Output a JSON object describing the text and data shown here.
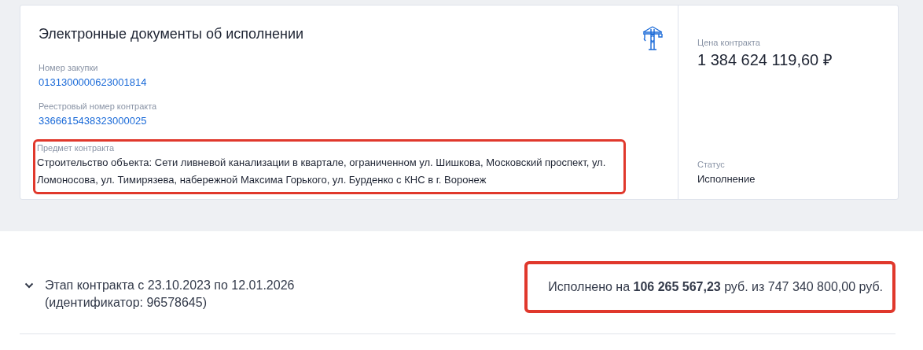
{
  "card": {
    "title": "Электронные документы об исполнении",
    "fields": [
      {
        "label": "Номер закупки",
        "value": "0131300000623001814",
        "kind": "link",
        "highlighted": false
      },
      {
        "label": "Реестровый номер контракта",
        "value": "3366615438323000025",
        "kind": "link",
        "highlighted": false
      },
      {
        "label": "Предмет контракта",
        "value": "Строительство объекта: Сети ливневой канализации в квартале, ограниченном ул. Шишкова, Московский проспект, ул. Ломоносова, ул. Тимирязева, набережной Максима Горького, ул. Бурденко с КНС в г. Воронеж",
        "kind": "text",
        "highlighted": true
      }
    ],
    "side": [
      {
        "label": "Цена контракта",
        "value": "1 384 624 119,60 ₽",
        "kind": "price"
      },
      {
        "label": "Статус",
        "value": "Исполнение",
        "kind": "text"
      }
    ]
  },
  "stage": {
    "expanded": false,
    "title": "Этап контракта с 23.10.2023 по 12.01.2026",
    "identifier": "(идентификатор: 96578645)",
    "progress": {
      "text": "Исполнено на **106 265 567,23** руб. из 747 340 800,00 руб.",
      "highlighted": true
    }
  }
}
